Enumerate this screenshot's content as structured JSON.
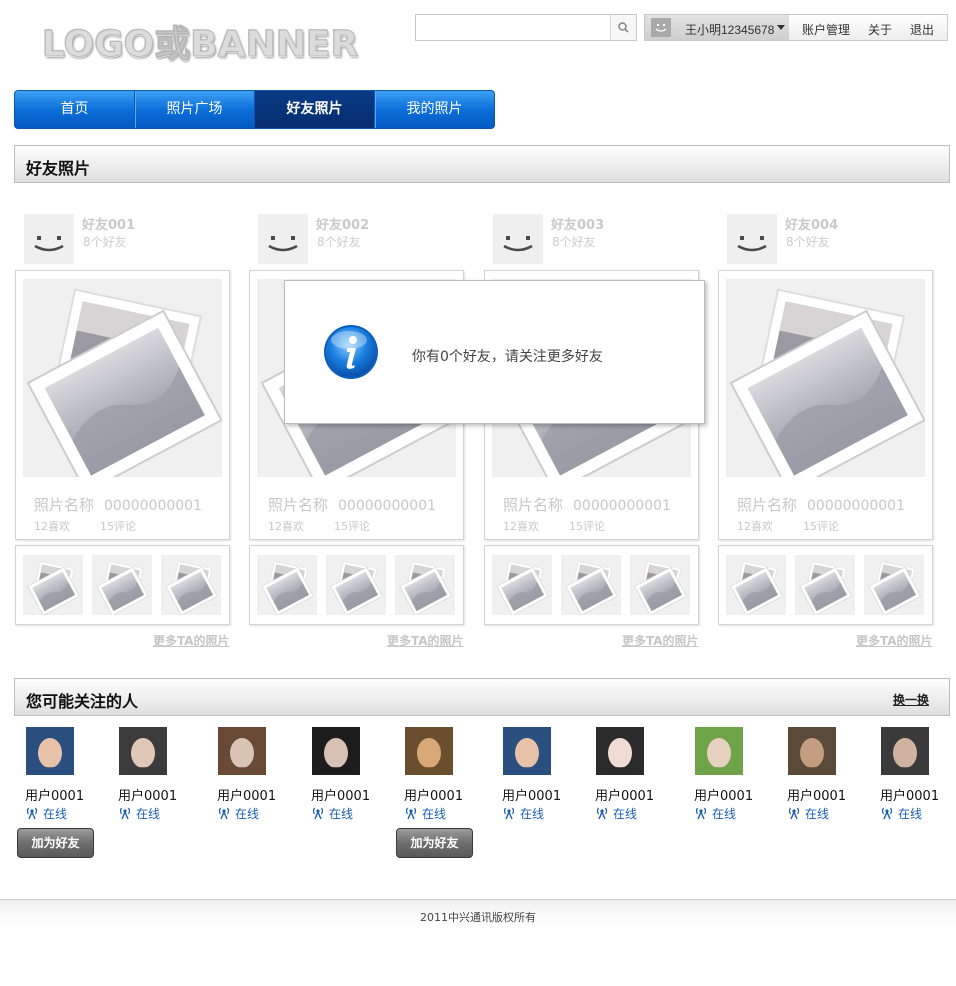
{
  "header": {
    "logo_text": "LOGO或BANNER",
    "search_placeholder": "",
    "user_name": "王小明12345678",
    "links": [
      "账户管理",
      "关于",
      "退出"
    ]
  },
  "nav": {
    "items": [
      "首页",
      "照片广场",
      "好友照片",
      "我的照片"
    ],
    "active": "好友照片"
  },
  "friends_section": {
    "title": "好友照片",
    "friends": [
      {
        "name": "好友001",
        "count": "8个好友",
        "photo_name": "照片名称",
        "photo_id": "00000000001",
        "likes": "12喜欢",
        "comments": "15评论",
        "more": "更多TA的照片"
      },
      {
        "name": "好友002",
        "count": "8个好友",
        "photo_name": "照片名称",
        "photo_id": "00000000001",
        "likes": "12喜欢",
        "comments": "15评论",
        "more": "更多TA的照片"
      },
      {
        "name": "好友003",
        "count": "8个好友",
        "photo_name": "照片名称",
        "photo_id": "00000000001",
        "likes": "12喜欢",
        "comments": "15评论",
        "more": "更多TA的照片"
      },
      {
        "name": "好友004",
        "count": "8个好友",
        "photo_name": "照片名称",
        "photo_id": "00000000001",
        "likes": "12喜欢",
        "comments": "15评论",
        "more": "更多TA的照片"
      }
    ]
  },
  "dialog": {
    "message": "你有0个好友，请关注更多好友",
    "icon": "info-icon"
  },
  "suggest_section": {
    "title": "您可能关注的人",
    "swap_label": "换一换",
    "add_label": "加为好友",
    "people": [
      {
        "name": "用户0001",
        "status": "在线",
        "photo_colors": [
          "#2a4f7f",
          "#e8c2a8"
        ],
        "has_add": true
      },
      {
        "name": "用户0001",
        "status": "在线",
        "photo_colors": [
          "#3b3b3b",
          "#e0c8b8"
        ],
        "has_add": false
      },
      {
        "name": "用户0001",
        "status": "在线",
        "photo_colors": [
          "#6a4a36",
          "#d9c3b5"
        ],
        "has_add": false
      },
      {
        "name": "用户0001",
        "status": "在线",
        "photo_colors": [
          "#1d1d1d",
          "#d7c0b4"
        ],
        "has_add": false
      },
      {
        "name": "用户0001",
        "status": "在线",
        "photo_colors": [
          "#6a4e2e",
          "#d8a977"
        ],
        "has_add": true
      },
      {
        "name": "用户0001",
        "status": "在线",
        "photo_colors": [
          "#2a4f7f",
          "#e8c2a8"
        ],
        "has_add": false
      },
      {
        "name": "用户0001",
        "status": "在线",
        "photo_colors": [
          "#2b2b2b",
          "#efdcd2"
        ],
        "has_add": false
      },
      {
        "name": "用户0001",
        "status": "在线",
        "photo_colors": [
          "#6fa34a",
          "#e6d0c0"
        ],
        "has_add": false
      },
      {
        "name": "用户0001",
        "status": "在线",
        "photo_colors": [
          "#5a4a3a",
          "#c29d80"
        ],
        "has_add": false
      },
      {
        "name": "用户0001",
        "status": "在线",
        "photo_colors": [
          "#3a3a3a",
          "#d0b2a0"
        ],
        "has_add": false
      }
    ]
  },
  "footer": {
    "text": "2011中兴通讯版权所有"
  },
  "colors": {
    "nav_blue": "#0c6fd9",
    "nav_active": "#062d6e",
    "status_blue": "#1b5eab"
  }
}
